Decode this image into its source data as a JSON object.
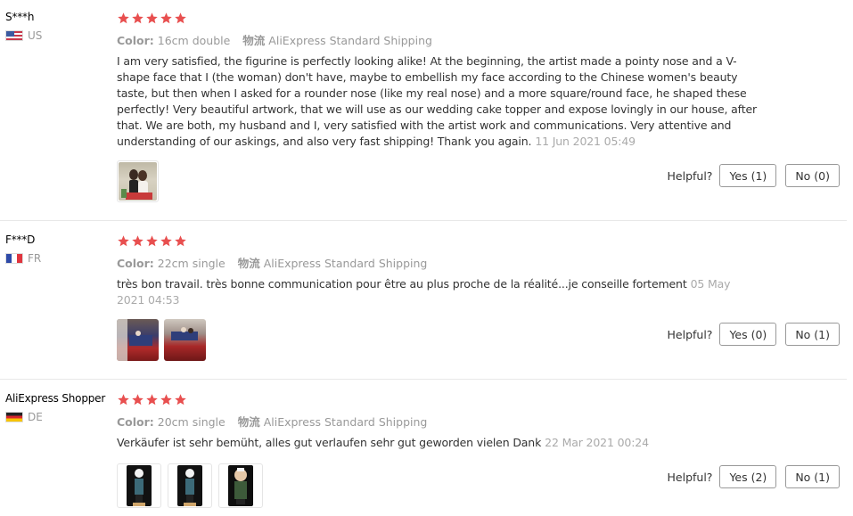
{
  "labels": {
    "color": "Color:",
    "shipping": "物流",
    "helpful": "Helpful?"
  },
  "star_color": "#e84f4f",
  "reviews": [
    {
      "user": "S***h",
      "country": "US",
      "stars": 5,
      "color_value": "16cm double",
      "shipping_value": "AliExpress Standard Shipping",
      "text": "I am very satisfied, the figurine is perfectly looking alike! At the beginning, the artist made a pointy nose and a V-shape face that I (the woman) don't have, maybe to embellish my face according to the Chinese women's beauty taste, but then when I asked for a rounder nose (like my real nose) and a more square/round face, he shaped these perfectly! Very beautiful artwork, that we will use as our wedding cake topper and expose lovingly in our house, after that. We are both, my husband and I, very satisfied with the artist work and communications. Very attentive and understanding of our askings, and also very fast shipping! Thank you again.",
      "date": "11 Jun 2021 05:49",
      "yes": "Yes (1)",
      "no": "No (0)"
    },
    {
      "user": "F***D",
      "country": "FR",
      "stars": 5,
      "color_value": "22cm single",
      "shipping_value": "AliExpress Standard Shipping",
      "text": "très bon travail. très bonne communication pour être au plus proche de la réalité...je conseille fortement",
      "date": "05 May 2021 04:53",
      "yes": "Yes (0)",
      "no": "No (1)"
    },
    {
      "user": "AliExpress Shopper",
      "country": "DE",
      "stars": 5,
      "color_value": "20cm single",
      "shipping_value": "AliExpress Standard Shipping",
      "text": "Verkäufer ist sehr bemüht, alles gut verlaufen sehr gut geworden vielen Dank",
      "date": "22 Mar 2021 00:24",
      "yes": "Yes (2)",
      "no": "No (1)"
    }
  ]
}
